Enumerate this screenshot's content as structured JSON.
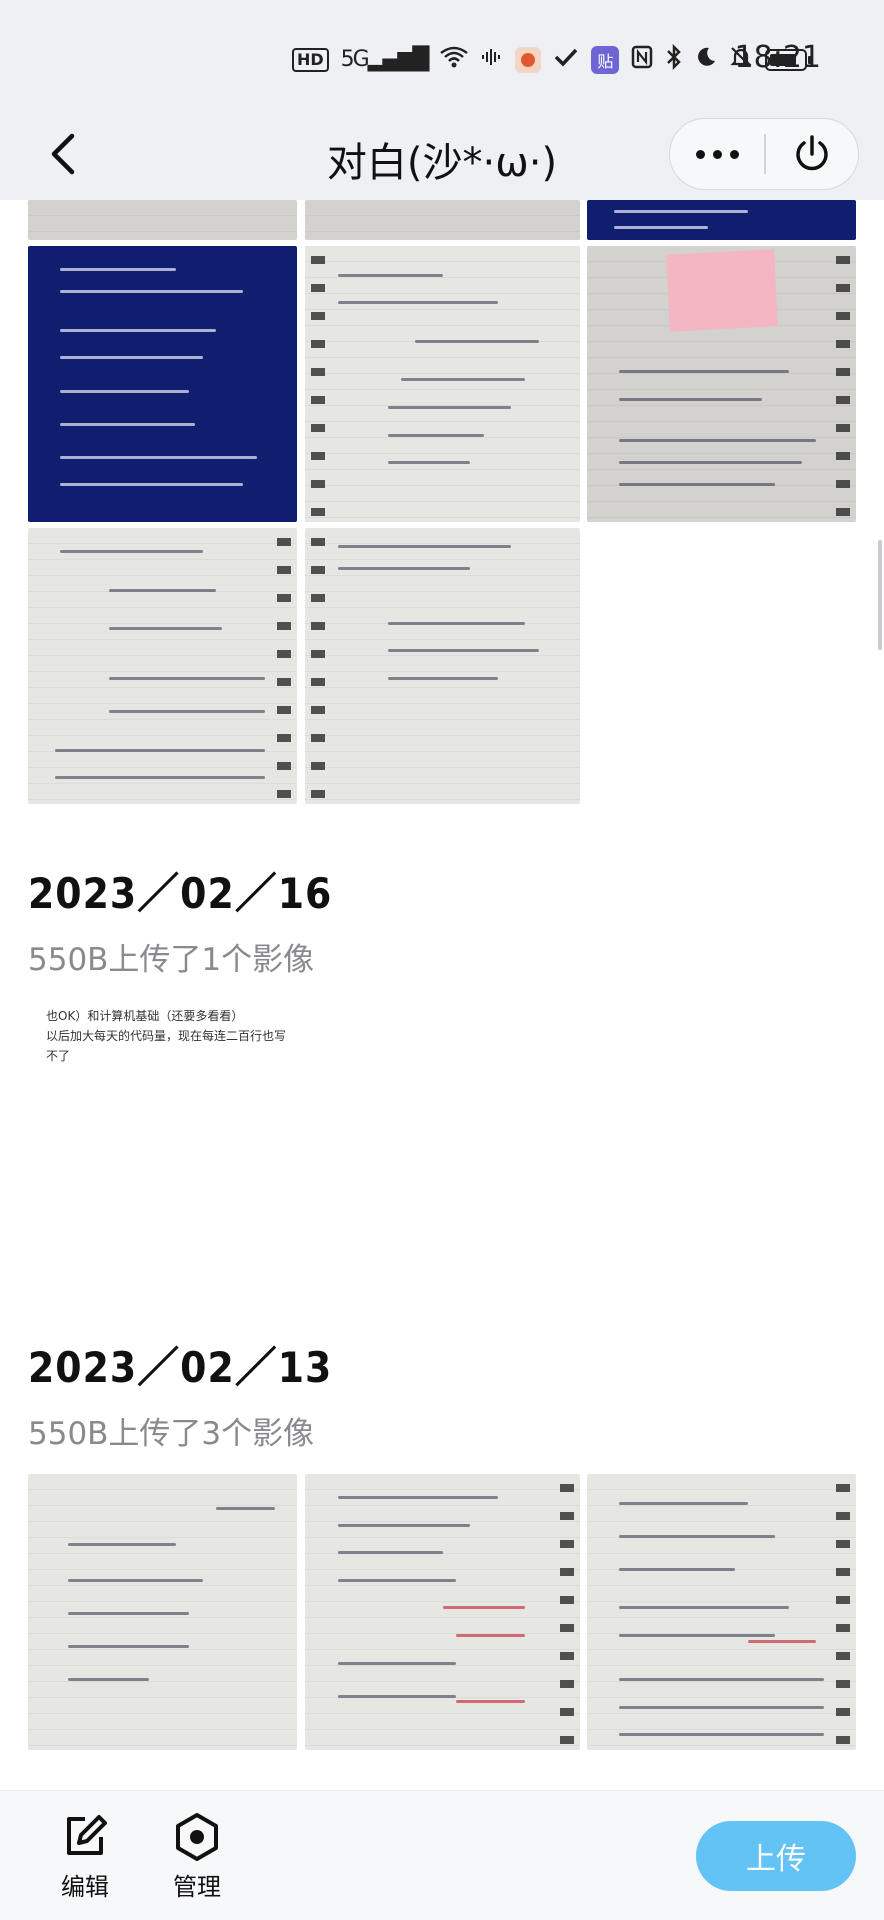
{
  "status_bar": {
    "hd": "HD",
    "network": "5G",
    "tie_app": "贴",
    "time": "18:21"
  },
  "nav": {
    "title": "对白(沙*·ω·)"
  },
  "groups": [
    {
      "photo_count": 8,
      "photos": [
        {
          "kind": "paper"
        },
        {
          "kind": "paper"
        },
        {
          "kind": "slide"
        },
        {
          "kind": "slide"
        },
        {
          "kind": "paper"
        },
        {
          "kind": "paper-note"
        },
        {
          "kind": "paper"
        },
        {
          "kind": "paper"
        }
      ]
    },
    {
      "date": "2023／02／16",
      "info": "550B上传了1个影像",
      "snippet": {
        "line1": "也OK）和计算机基础（还要多看看）",
        "line2": "以后加大每天的代码量，现在每连二百行也写",
        "line3": "不了"
      }
    },
    {
      "date": "2023／02／13",
      "info": "550B上传了3个影像",
      "photos": [
        {
          "kind": "paper"
        },
        {
          "kind": "paper"
        },
        {
          "kind": "paper"
        }
      ]
    }
  ],
  "bottom": {
    "edit_label": "编辑",
    "manage_label": "管理",
    "upload_label": "上传"
  },
  "colors": {
    "upload_button": "#63c3f4",
    "status_bg": "#eef0f3",
    "muted_text": "#8a8a8e"
  }
}
